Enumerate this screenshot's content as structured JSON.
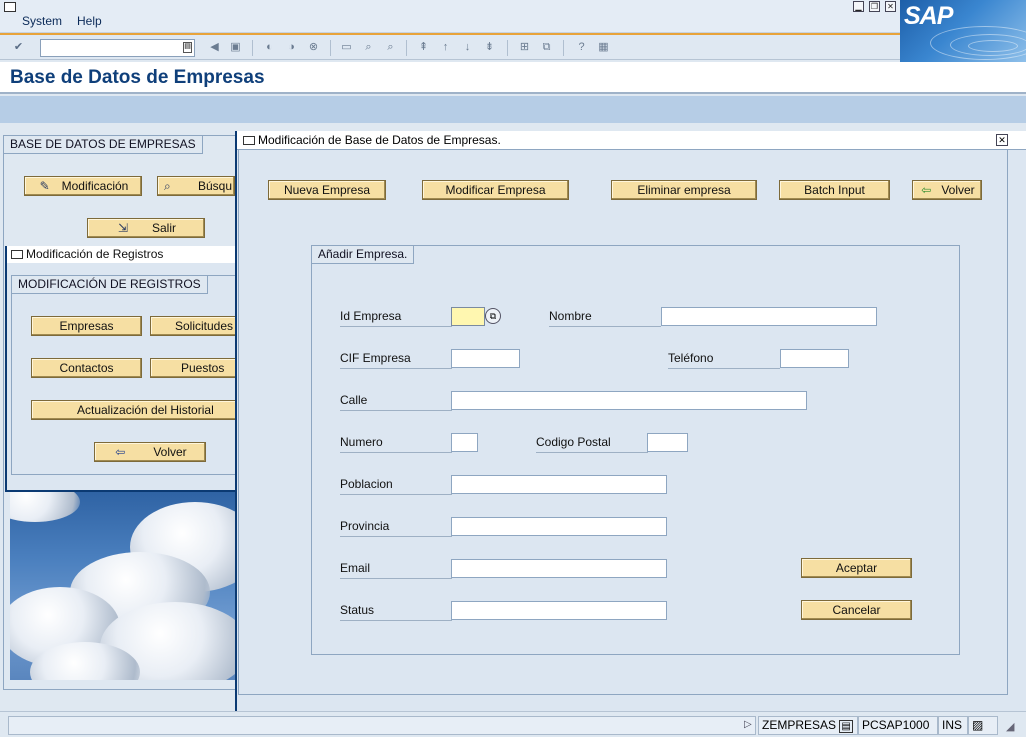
{
  "menu": {
    "system": "System",
    "help": "Help"
  },
  "window_controls": {
    "minimize": "▁",
    "restore": "❐",
    "close": "✕"
  },
  "logo": {
    "text": "SAP"
  },
  "toolbar": {
    "command_value": "",
    "icons": [
      "check-icon",
      "save-icon",
      "back-icon",
      "exit-icon",
      "cancel-icon",
      "print-icon",
      "find-icon",
      "find-next-icon",
      "first-page-icon",
      "prev-page-icon",
      "next-page-icon",
      "last-page-icon",
      "new-session-icon",
      "shortcut-icon",
      "help-icon",
      "layout-icon"
    ]
  },
  "page": {
    "title": "Base de Datos de Empresas"
  },
  "bg_panel": {
    "group_title": "BASE DE DATOS DE EMPRESAS",
    "btn_modificacion": "Modificación",
    "btn_busqueda": "Búsqu",
    "btn_salir": "Salir"
  },
  "sub_window": {
    "title": "Modificación de Registros",
    "group_title": "MODIFICACIÓN DE REGISTROS",
    "btn_empresas": "Empresas",
    "btn_solicitudes": "Solicitudes",
    "btn_contactos": "Contactos",
    "btn_puestos": "Puestos",
    "btn_actualizacion": "Actualización del Historial",
    "btn_volver": "Volver"
  },
  "dialog": {
    "title": "Modificación de Base de Datos de Empresas.",
    "buttons": {
      "nueva": "Nueva Empresa",
      "modificar": "Modificar Empresa",
      "eliminar": "Eliminar empresa",
      "batch": "Batch Input",
      "volver": "Volver"
    },
    "group_title": "Añadir Empresa.",
    "fields": {
      "id_empresa": {
        "label": "Id Empresa",
        "value": ""
      },
      "nombre": {
        "label": "Nombre",
        "value": ""
      },
      "cif": {
        "label": "CIF Empresa",
        "value": ""
      },
      "telefono": {
        "label": "Teléfono",
        "value": ""
      },
      "calle": {
        "label": "Calle",
        "value": ""
      },
      "numero": {
        "label": "Numero",
        "value": ""
      },
      "codigo_postal": {
        "label": "Codigo Postal",
        "value": ""
      },
      "poblacion": {
        "label": "Poblacion",
        "value": ""
      },
      "provincia": {
        "label": "Provincia",
        "value": ""
      },
      "email": {
        "label": "Email",
        "value": ""
      },
      "status": {
        "label": "Status",
        "value": ""
      }
    },
    "aceptar": "Aceptar",
    "cancelar": "Cancelar"
  },
  "status": {
    "program": "ZEMPRESAS",
    "server": "PCSAP1000",
    "mode": "INS"
  },
  "colors": {
    "accent_orange": "#e8a33a",
    "title_blue": "#0f3f7a",
    "button_yellow": "#f6dfa3",
    "field_focus": "#fff7b0"
  }
}
